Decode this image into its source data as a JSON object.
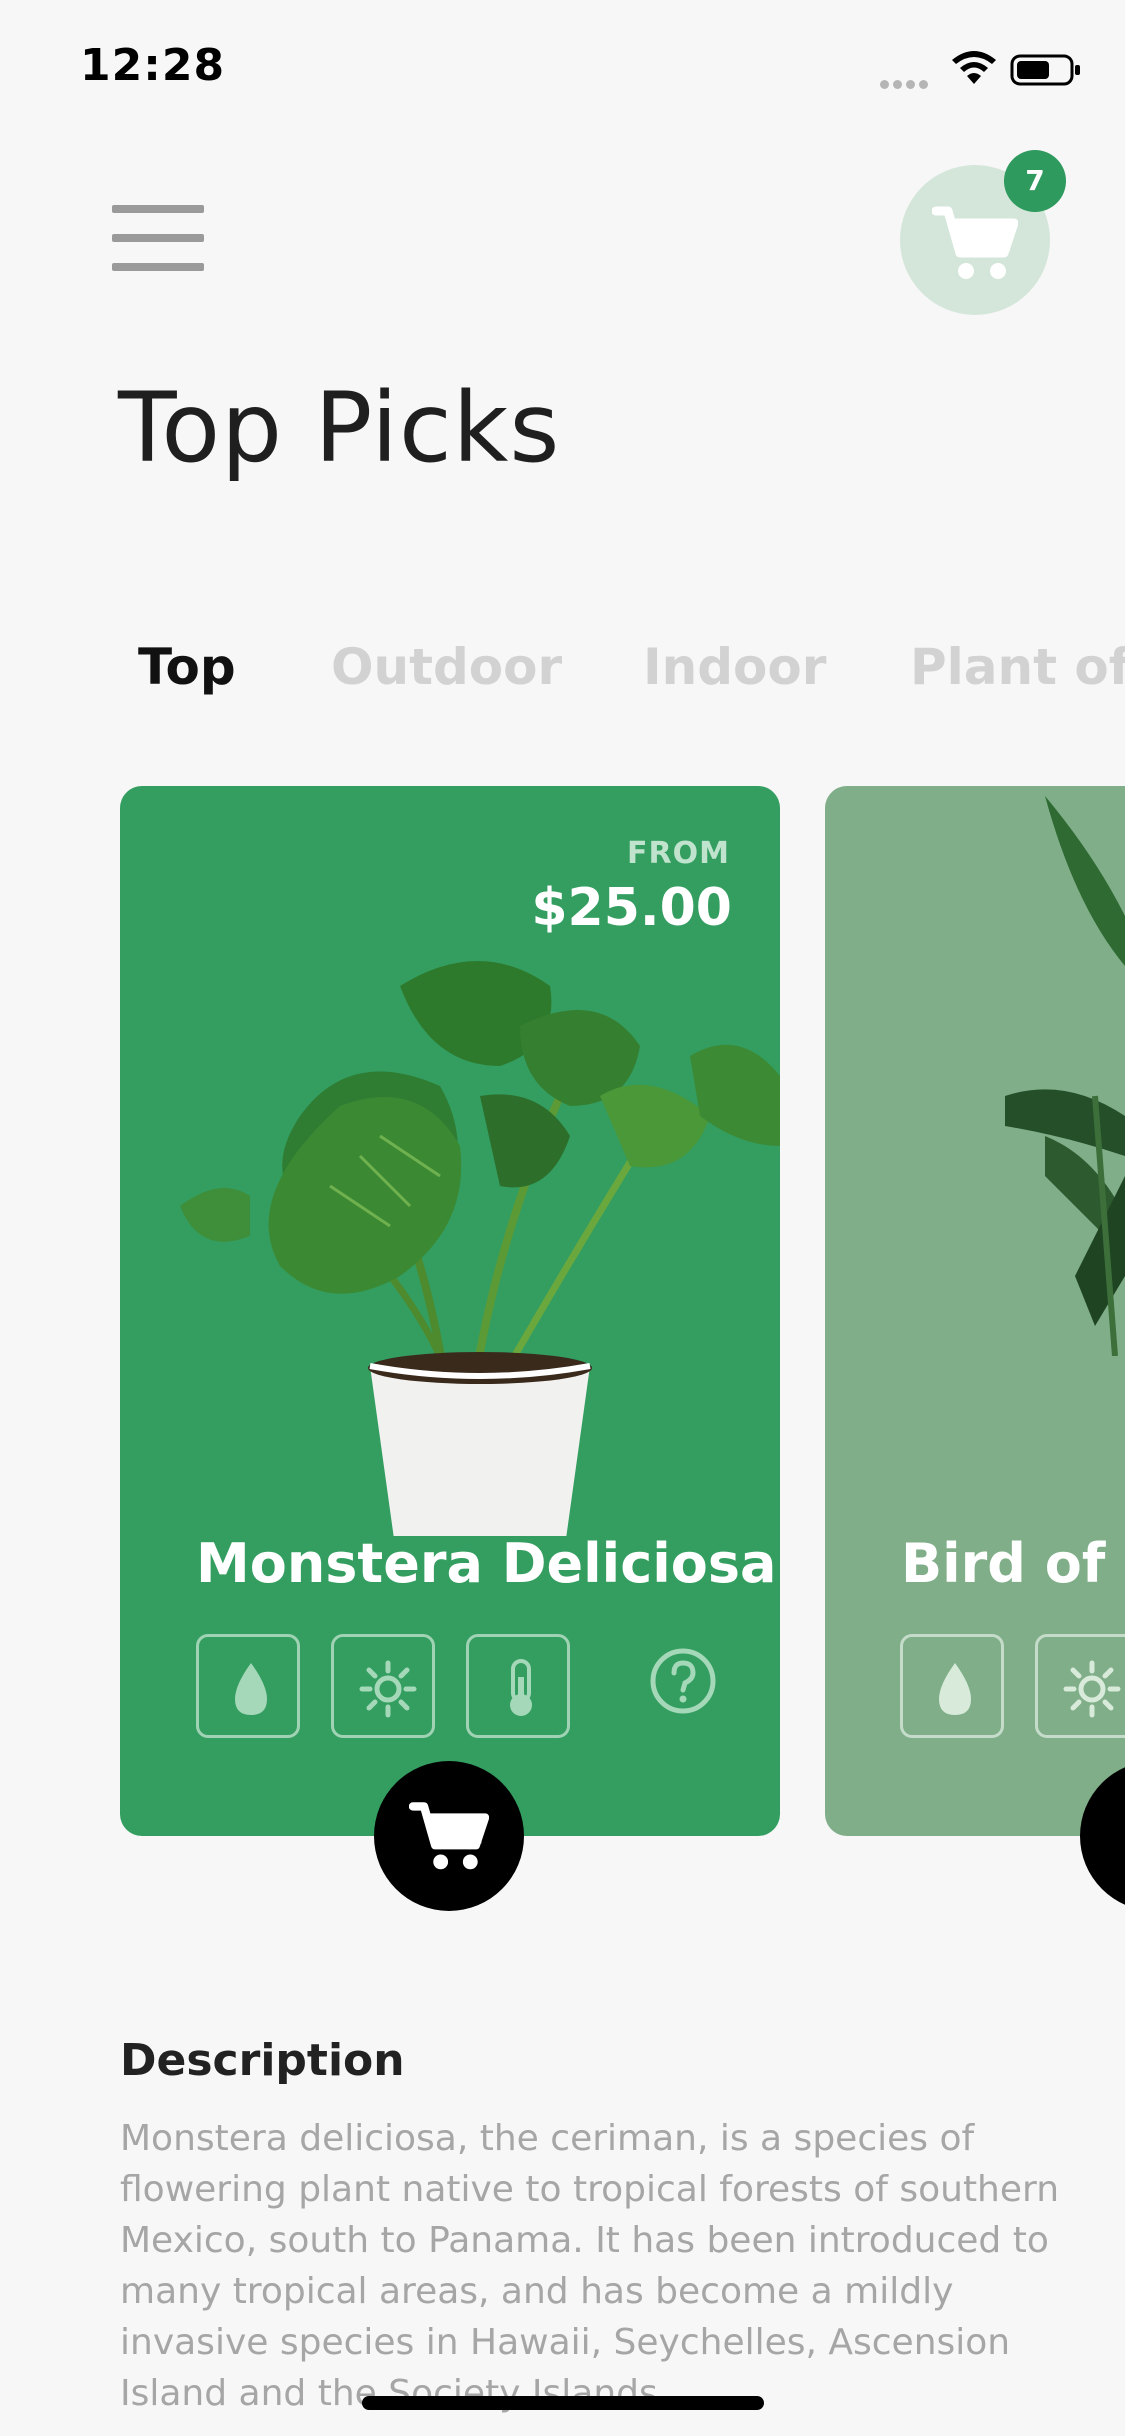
{
  "status_bar": {
    "time": "12:28"
  },
  "header": {
    "cart_count": "7"
  },
  "page_title": "Top Picks",
  "tabs": [
    {
      "label": "Top",
      "active": true
    },
    {
      "label": "Outdoor",
      "active": false
    },
    {
      "label": "Indoor",
      "active": false
    },
    {
      "label": "Plant of the Month",
      "active": false
    }
  ],
  "cards": [
    {
      "from_label": "FROM",
      "price": "$25.00",
      "name": "Monstera Deliciosa",
      "icons": [
        "water-drop-icon",
        "sun-icon",
        "thermometer-icon",
        "help-icon"
      ]
    },
    {
      "name": "Bird of Paradise",
      "icons": [
        "water-drop-icon",
        "sun-icon"
      ]
    }
  ],
  "description": {
    "heading": "Description",
    "body": "Monstera deliciosa, the ceriman, is a species of flowering plant native to tropical forests of southern Mexico, south to Panama. It has been introduced to many tropical areas, and has become a mildly invasive species in Hawaii, Seychelles, Ascension Island and the Society Islands."
  },
  "colors": {
    "accent": "#339e60",
    "card_secondary": "#7fae88",
    "badge": "#2e9a5e"
  }
}
